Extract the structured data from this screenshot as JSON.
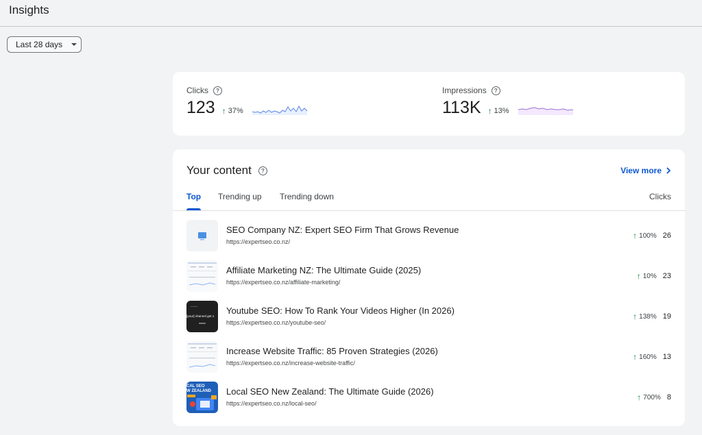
{
  "header": {
    "title": "Insights"
  },
  "filter": {
    "date_range": "Last 28 days",
    "caret_icon": "dropdown-caret-icon"
  },
  "metrics": {
    "clicks": {
      "label": "Clicks",
      "value": "123",
      "change": "37%",
      "trend": "up",
      "spark_color": "#5b86e5"
    },
    "impressions": {
      "label": "Impressions",
      "value": "113K",
      "change": "13%",
      "trend": "up",
      "spark_color": "#9c6fd6"
    }
  },
  "content": {
    "title": "Your content",
    "view_more": "View more",
    "tabs": [
      "Top",
      "Trending up",
      "Trending down"
    ],
    "active_tab": "Top",
    "column_header": "Clicks",
    "rows": [
      {
        "title": "SEO Company NZ: Expert SEO Firm That Grows Revenue",
        "url": "https://expertseo.co.nz/",
        "change": "100%",
        "clicks": "26"
      },
      {
        "title": "Affiliate Marketing NZ: The Ultimate Guide (2025)",
        "url": "https://expertseo.co.nz/affiliate-marketing/",
        "change": "10%",
        "clicks": "23"
      },
      {
        "title": "Youtube SEO: How To Rank Your Videos Higher (In 2026)",
        "url": "https://expertseo.co.nz/youtube-seo/",
        "change": "138%",
        "clicks": "19"
      },
      {
        "title": "Increase Website Traffic: 85 Proven Strategies (2026)",
        "url": "https://expertseo.co.nz/increase-website-traffic/",
        "change": "160%",
        "clicks": "13"
      },
      {
        "title": "Local SEO New Zealand: The Ultimate Guide (2026)",
        "url": "https://expertseo.co.nz/local-seo/",
        "change": "700%",
        "clicks": "8"
      }
    ],
    "thumb_text": {
      "youtube": "[your] channel get 1",
      "local": [
        "CAL SEO",
        "W ZEALAND"
      ]
    }
  }
}
